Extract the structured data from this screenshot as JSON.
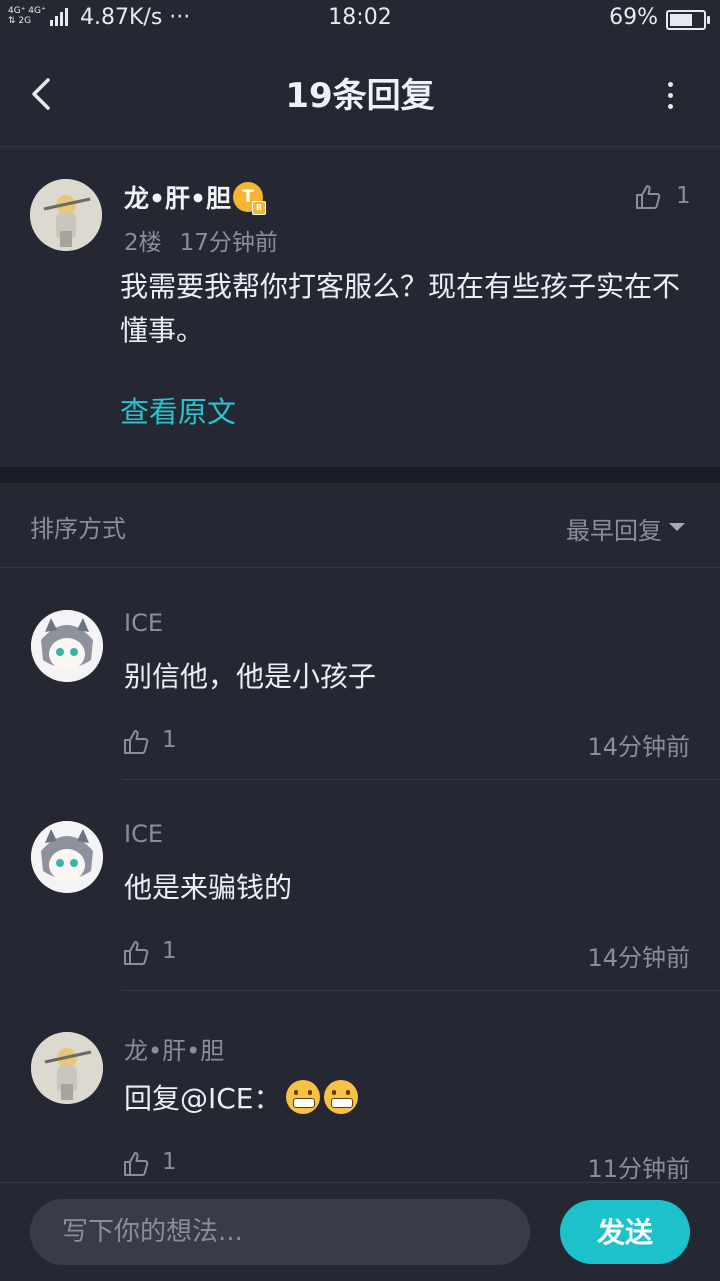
{
  "status_bar": {
    "network_top": "4G⁺ 4G⁺",
    "network_bottom": "⇅ 2G",
    "speed": "4.87K/s ···",
    "time": "18:02",
    "battery": "69%",
    "battery_level": 0.69
  },
  "header": {
    "title": "19条回复"
  },
  "main_comment": {
    "author": "龙•肝•胆",
    "badge": "T",
    "badge_sub": "B",
    "floor": "2楼",
    "time": "17分钟前",
    "likes": "1",
    "text": "我需要我帮你打客服么？现在有些孩子实在不懂事。",
    "view_original": "查看原文"
  },
  "sort": {
    "label": "排序方式",
    "value": "最早回复"
  },
  "replies": [
    {
      "author": "ICE",
      "text": "别信他，他是小孩子",
      "likes": "1",
      "time": "14分钟前"
    },
    {
      "author": "ICE",
      "text": "他是来骗钱的",
      "likes": "1",
      "time": "14分钟前"
    },
    {
      "author": "龙•肝•胆",
      "text": "回复@ICE：",
      "emoji_count": 2,
      "likes": "1",
      "time": "11分钟前"
    }
  ],
  "composer": {
    "placeholder": "写下你的想法...",
    "send_label": "发送"
  },
  "colors": {
    "background": "#252733",
    "accent": "#1cc1c9",
    "link": "#27c3cf",
    "badge": "#f3b532"
  }
}
